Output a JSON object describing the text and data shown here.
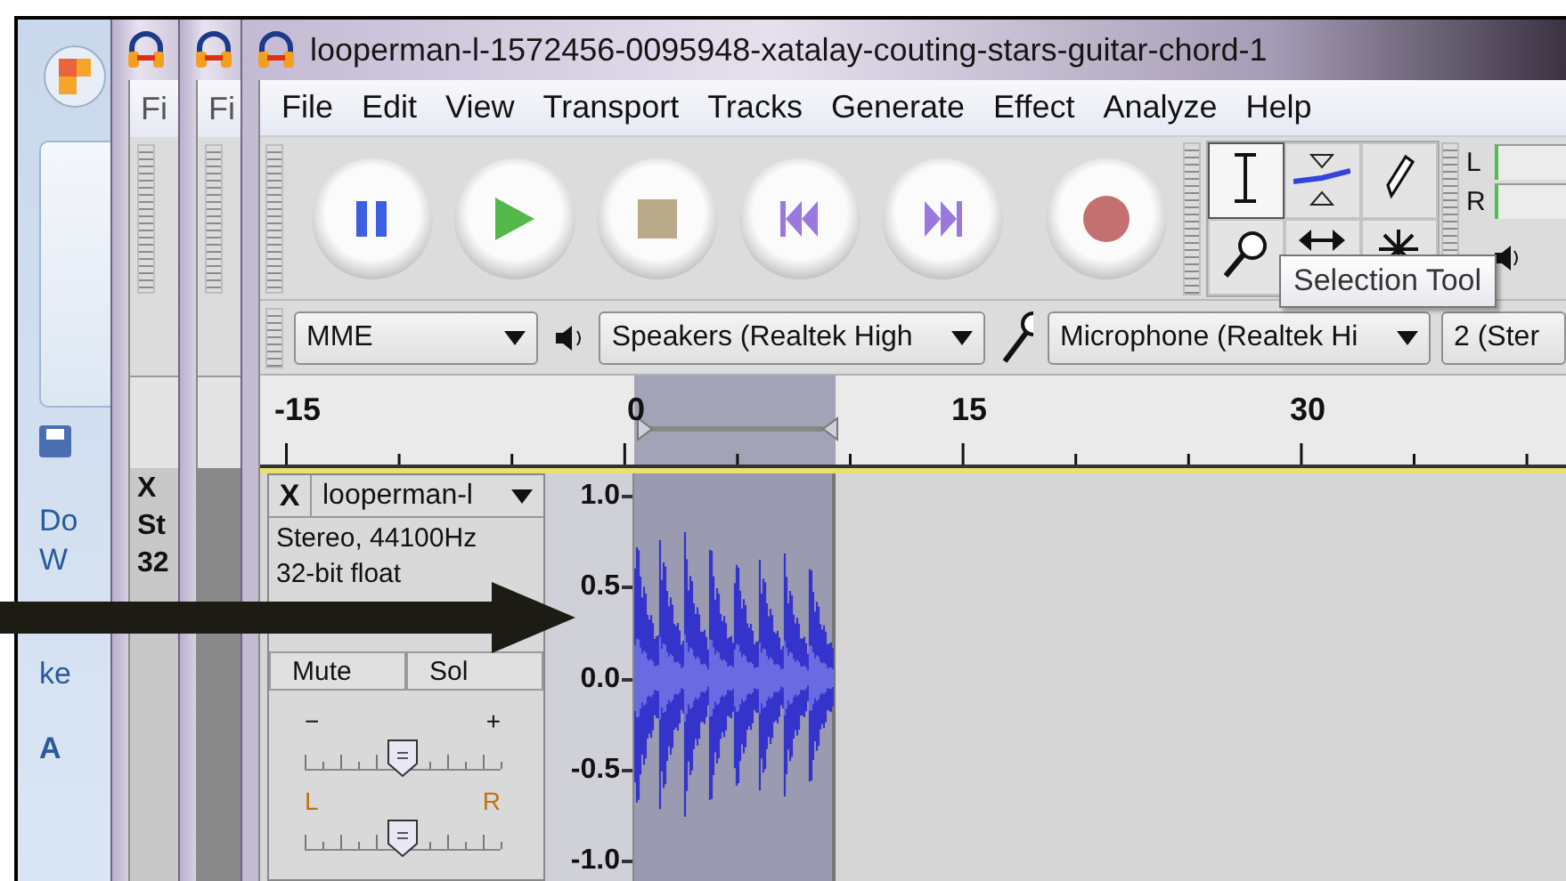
{
  "background": {
    "office_texts": [
      "Do",
      "W",
      "ke",
      "A"
    ],
    "windows": [
      {
        "menu_text": "Fi",
        "track_texts": [
          "X",
          "St",
          "32"
        ]
      },
      {
        "menu_text": "Fi"
      }
    ]
  },
  "window": {
    "title": "looperman-l-1572456-0095948-xatalay-couting-stars-guitar-chord-1"
  },
  "menu": [
    "File",
    "Edit",
    "View",
    "Transport",
    "Tracks",
    "Generate",
    "Effect",
    "Analyze",
    "Help"
  ],
  "transport": [
    {
      "kind": "pause"
    },
    {
      "kind": "play"
    },
    {
      "kind": "stop"
    },
    {
      "kind": "skip-start"
    },
    {
      "kind": "skip-end"
    },
    {
      "kind": "record"
    }
  ],
  "tools": [
    {
      "kind": "select",
      "selected": true
    },
    {
      "kind": "envelope",
      "selected": false
    },
    {
      "kind": "draw",
      "selected": false
    },
    {
      "kind": "zoom",
      "selected": false
    },
    {
      "kind": "timeshift",
      "selected": false
    },
    {
      "kind": "multi",
      "selected": false
    }
  ],
  "meter": {
    "channels": [
      "L",
      "R"
    ]
  },
  "tooltip": "Selection Tool",
  "devices": {
    "host": "MME",
    "output": "Speakers (Realtek High",
    "input": "Microphone (Realtek Hi",
    "channels": "2 (Ster"
  },
  "ruler": {
    "labels": [
      "-15",
      "0",
      "15",
      "30"
    ]
  },
  "track": {
    "close": "X",
    "name": "looperman-l",
    "info": [
      "Stereo, 44100Hz",
      "32-bit float"
    ],
    "buttons": [
      "Mute",
      "Sol"
    ],
    "gain": {
      "minus": "−",
      "plus": "+",
      "level": 0.5
    },
    "pan": {
      "left": "L",
      "right": "R",
      "level": 0.5
    },
    "scale": [
      "1.0",
      "0.5",
      "0.0",
      "-0.5",
      "-1.0"
    ]
  }
}
